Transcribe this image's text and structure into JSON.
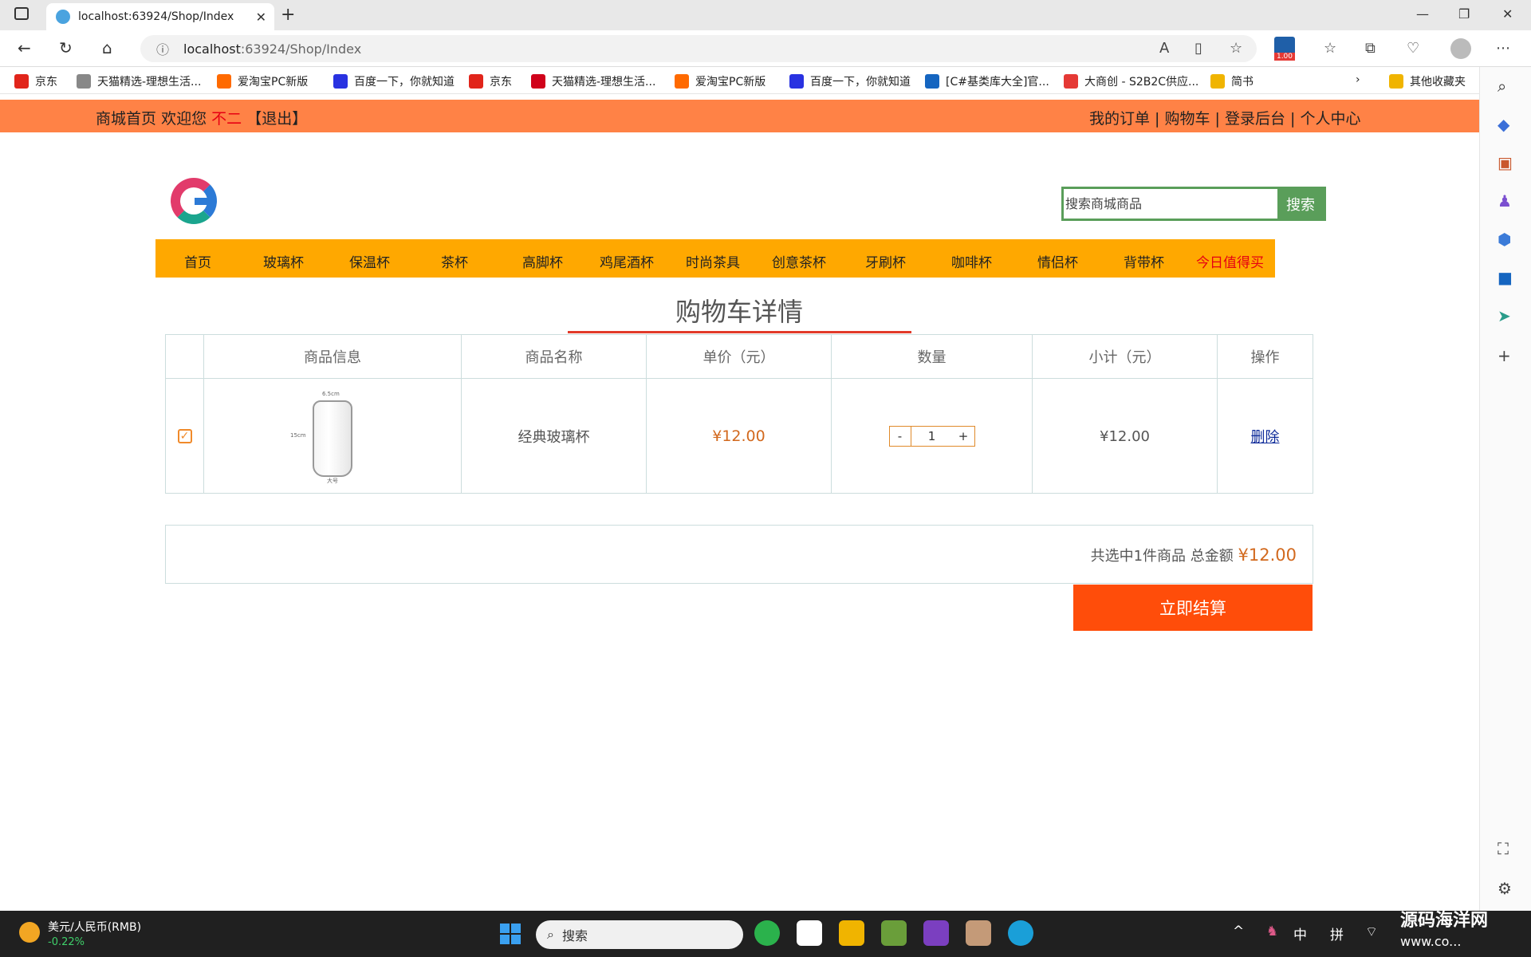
{
  "browser": {
    "tab_title": "localhost:63924/Shop/Index",
    "url_host": "localhost",
    "url_rest": ":63924/Shop/Index",
    "ext_badge": "1.00"
  },
  "bookmarks": [
    {
      "label": "京东",
      "icon": "JD",
      "color": "#e1251b"
    },
    {
      "label": "天猫精选-理想生活...",
      "icon": "doc",
      "color": "#888888"
    },
    {
      "label": "爱淘宝PC新版",
      "icon": "淘",
      "color": "#ff6a00"
    },
    {
      "label": "百度一下，你就知道",
      "icon": "baidu",
      "color": "#2932e1"
    },
    {
      "label": "京东",
      "icon": "JD",
      "color": "#e1251b"
    },
    {
      "label": "天猫精选-理想生活...",
      "icon": "T",
      "color": "#d0021b"
    },
    {
      "label": "爱淘宝PC新版",
      "icon": "淘",
      "color": "#ff6a00"
    },
    {
      "label": "百度一下，你就知道",
      "icon": "baidu",
      "color": "#2932e1"
    },
    {
      "label": "[C#基类库大全]官...",
      "icon": "C",
      "color": "#1565c0"
    },
    {
      "label": "大商创 - S2B2C供应...",
      "icon": "cube",
      "color": "#e53935"
    },
    {
      "label": "简书",
      "icon": "folder",
      "color": "#f0b400"
    }
  ],
  "bookmarks_other": "其他收藏夹",
  "site": {
    "topbar_home": "商城首页",
    "topbar_welcome": "欢迎您",
    "topbar_user": "不二",
    "topbar_logout": "【退出】",
    "topbar_links": "我的订单 | 购物车 | 登录后台 | 个人中心",
    "search_placeholder": "搜索商城商品",
    "search_button": "搜索",
    "categories": [
      "首页",
      "玻璃杯",
      "保温杯",
      "茶杯",
      "高脚杯",
      "鸡尾酒杯",
      "时尚茶具",
      "创意茶杯",
      "牙刷杯",
      "咖啡杯",
      "情侣杯",
      "背带杯",
      "今日值得买"
    ],
    "cart_title": "购物车详情"
  },
  "cart": {
    "headers": [
      "商品信息",
      "商品名称",
      "单价（元）",
      "数量",
      "小计（元）",
      "操作"
    ],
    "row": {
      "name": "经典玻璃杯",
      "price": "¥12.00",
      "qty_minus": "-",
      "qty": "1",
      "qty_plus": "+",
      "subtotal": "¥12.00",
      "action": "删除",
      "img_label_top": "6.5cm",
      "img_label_side": "15cm",
      "img_label_bottom": "大号"
    },
    "summary_prefix": "共选中",
    "summary_count": "1",
    "summary_mid": "件商品 总金额",
    "summary_total": "¥12.00",
    "checkout": "立即结算"
  },
  "taskbar": {
    "fx_name": "美元/人民币(RMB)",
    "fx_change": "-0.22%",
    "search": "搜索",
    "ime_lang": "中",
    "ime_mode": "拼",
    "watermark": "源码海洋网",
    "watermark_sub": "www.co..."
  }
}
